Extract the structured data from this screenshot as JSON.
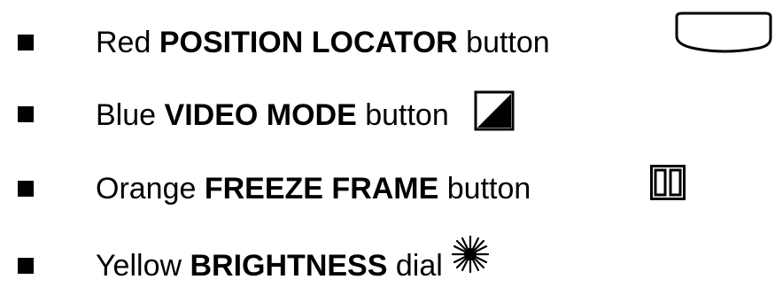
{
  "items": [
    {
      "color": "Red",
      "name": "POSITION LOCATOR",
      "kind": "button",
      "icon": "oval-button-icon"
    },
    {
      "color": "Blue",
      "name": "VIDEO MODE",
      "kind": "button",
      "icon": "contrast-triangle-icon"
    },
    {
      "color": "Orange",
      "name": "FREEZE FRAME",
      "kind": "button",
      "icon": "pause-icon"
    },
    {
      "color": "Yellow",
      "name": "BRIGHTNESS",
      "kind": "dial",
      "icon": "sun-burst-icon"
    }
  ]
}
